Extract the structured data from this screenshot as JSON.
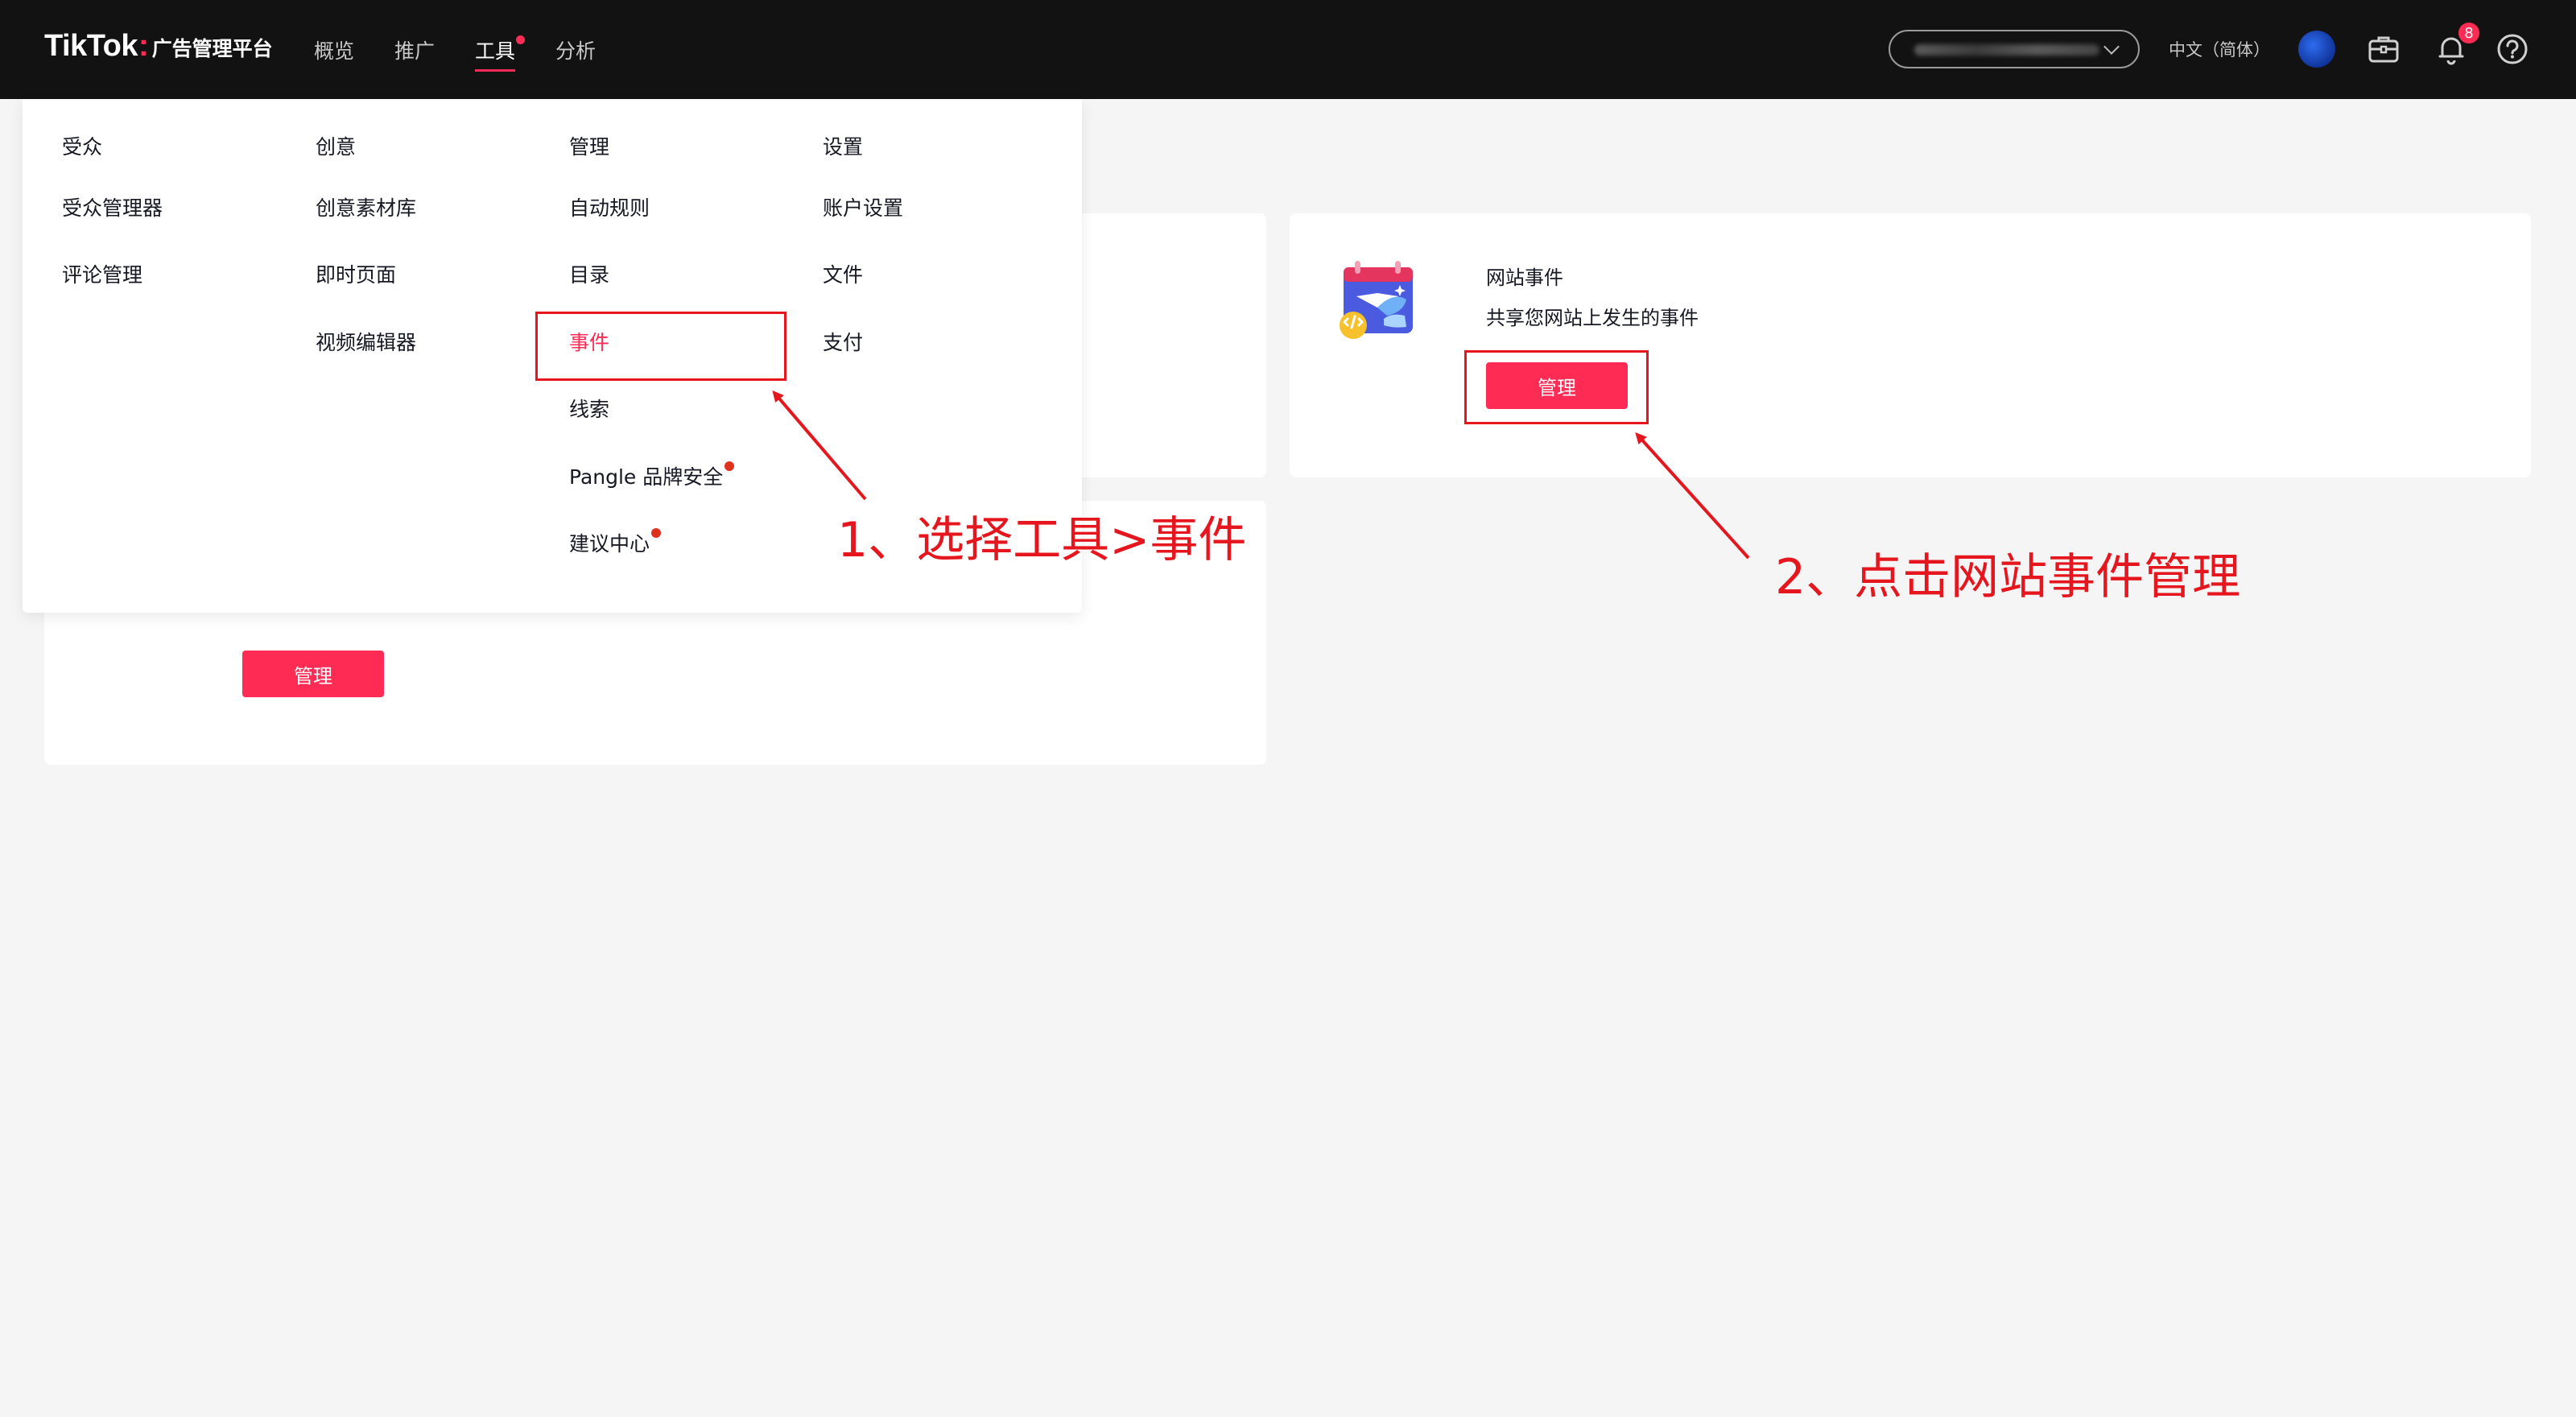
{
  "header": {
    "logo_main": "TikTok",
    "logo_sep": ":",
    "logo_sub": "广告管理平台",
    "nav": [
      {
        "label": "概览",
        "active": false
      },
      {
        "label": "推广",
        "active": false
      },
      {
        "label": "工具",
        "active": true,
        "has_dot": true
      },
      {
        "label": "分析",
        "active": false
      }
    ],
    "language": "中文（简体）",
    "notification_count": "8",
    "icons": [
      "avatar",
      "briefcase-icon",
      "bell-icon",
      "help-icon"
    ]
  },
  "dropdown": {
    "columns": [
      {
        "head": "受众",
        "items": [
          {
            "label": "受众管理器"
          },
          {
            "label": "评论管理"
          }
        ]
      },
      {
        "head": "创意",
        "items": [
          {
            "label": "创意素材库"
          },
          {
            "label": "即时页面"
          },
          {
            "label": "视频编辑器"
          }
        ]
      },
      {
        "head": "管理",
        "items": [
          {
            "label": "自动规则"
          },
          {
            "label": "目录"
          },
          {
            "label": "事件",
            "selected": true
          },
          {
            "label": "线索"
          },
          {
            "label": "Pangle 品牌安全",
            "dot": true
          },
          {
            "label": "建议中心",
            "dot": true
          }
        ]
      },
      {
        "head": "设置",
        "items": [
          {
            "label": "账户设置"
          },
          {
            "label": "文件"
          },
          {
            "label": "支付"
          }
        ]
      }
    ]
  },
  "cards": {
    "website_events": {
      "title": "网站事件",
      "description": "共享您网站上发生的事件",
      "button": "管理",
      "icon": "website-events-illustration"
    },
    "card3": {
      "button": "管理"
    }
  },
  "annotations": {
    "step1": "1、选择工具>事件",
    "step2": "2、点击网站事件管理",
    "color": "#e5161d"
  },
  "colors": {
    "brand": "#fe2c55",
    "topbar": "#121212",
    "page_bg": "#f5f5f5"
  }
}
